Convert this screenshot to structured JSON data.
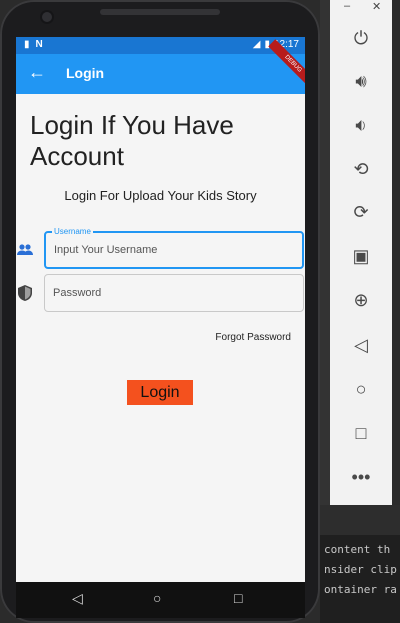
{
  "status_bar": {
    "time": "12:17",
    "left_icons": [
      "sd-card-icon",
      "n-notification-icon"
    ],
    "right_icons": [
      "signal-icon",
      "battery-icon"
    ]
  },
  "app_bar": {
    "title": "Login",
    "debug_banner": "DEBUG"
  },
  "main": {
    "headline": "Login If You Have Account",
    "subtitle": "Login For Upload Your Kids Story",
    "username": {
      "label": "Username",
      "placeholder": "Input Your Username",
      "value": ""
    },
    "password": {
      "placeholder": "Password",
      "value": ""
    },
    "forgot_password": "Forgot Password",
    "login_button": "Login"
  },
  "colors": {
    "app_bar": "#2196f3",
    "status_bar": "#1976d2",
    "login_button": "#f4511e",
    "focused_border": "#2196f3"
  },
  "emulator_toolbar": {
    "window_controls": [
      "minimize-icon",
      "close-icon"
    ],
    "buttons": [
      "power-icon",
      "volume-up-icon",
      "volume-down-icon",
      "rotate-left-icon",
      "rotate-right-icon",
      "camera-icon",
      "zoom-icon",
      "back-icon",
      "home-icon",
      "overview-icon",
      "more-icon"
    ]
  },
  "editor_snippet": {
    "lines": [
      "content th",
      "nsider clip",
      "ontainer ra"
    ]
  }
}
